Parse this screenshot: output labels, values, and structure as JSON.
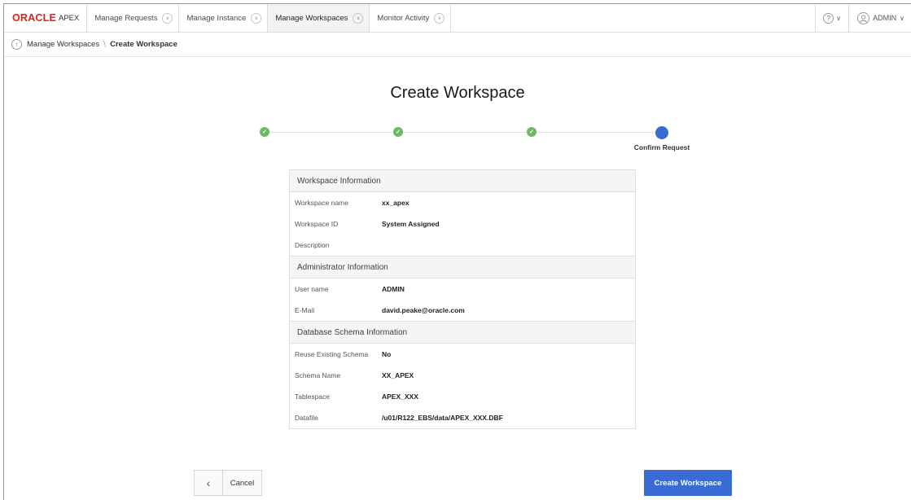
{
  "header": {
    "logo_brand": "ORACLE",
    "logo_product": "APEX",
    "tabs": [
      {
        "label": "Manage Requests"
      },
      {
        "label": "Manage Instance"
      },
      {
        "label": "Manage Workspaces"
      },
      {
        "label": "Monitor Activity"
      }
    ],
    "active_tab": "Manage Workspaces",
    "help_icon": "help-circle-icon",
    "user_label": "ADMIN"
  },
  "breadcrumb": {
    "parent": "Manage Workspaces",
    "current": "Create Workspace"
  },
  "page_title": "Create Workspace",
  "progress": {
    "steps": [
      {
        "state": "complete",
        "label": ""
      },
      {
        "state": "complete",
        "label": ""
      },
      {
        "state": "complete",
        "label": ""
      },
      {
        "state": "current",
        "label": "Confirm Request"
      }
    ]
  },
  "summary": {
    "sections": [
      {
        "title": "Workspace Information",
        "rows": [
          {
            "label": "Workspace name",
            "value": "xx_apex"
          },
          {
            "label": "Workspace ID",
            "value": "System Assigned"
          },
          {
            "label": "Description",
            "value": ""
          }
        ]
      },
      {
        "title": "Administrator Information",
        "rows": [
          {
            "label": "User name",
            "value": "ADMIN"
          },
          {
            "label": "E-Mail",
            "value": "david.peake@oracle.com"
          }
        ]
      },
      {
        "title": "Database Schema Information",
        "rows": [
          {
            "label": "Reuse Existing Schema",
            "value": "No"
          },
          {
            "label": "Schema Name",
            "value": "XX_APEX"
          },
          {
            "label": "Tablespace",
            "value": "APEX_XXX"
          },
          {
            "label": "Datafile",
            "value": "/u01/R122_EBS/data/APEX_XXX.DBF"
          }
        ]
      }
    ]
  },
  "buttons": {
    "cancel_label": "Cancel",
    "create_label": "Create Workspace"
  },
  "colors": {
    "accent": "#3a6ad3",
    "complete": "#6cba65",
    "brand_red": "#e2231a"
  }
}
